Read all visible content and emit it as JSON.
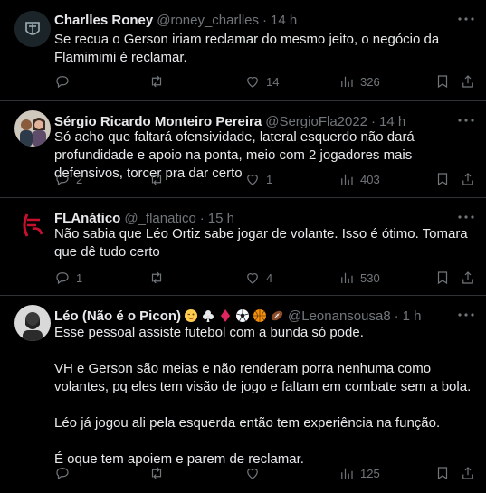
{
  "tweets": [
    {
      "name": "Charlles Roney",
      "handle": "@roney_charlles",
      "time": "14 h",
      "text": "Se recua o Gerson iriam reclamar do mesmo jeito, o negócio da Flamimimi é reclamar.",
      "replies": "",
      "retweets": "",
      "likes": "14",
      "views": "326"
    },
    {
      "name": "Sérgio Ricardo Monteiro Pereira",
      "handle": "@SergioFla2022",
      "time": "14 h",
      "text": "Só acho que faltará ofensividade, lateral esquerdo não dará profundidade e apoio na ponta, meio com 2 jogadores mais defensivos, torcer pra dar certo",
      "replies": "2",
      "retweets": "",
      "likes": "1",
      "views": "403"
    },
    {
      "name": "FLAnático",
      "handle": "@_flanatico",
      "time": "15 h",
      "text": "Não sabia que Léo Ortiz sabe jogar de volante. Isso é ótimo. Tomara que dê tudo certo",
      "replies": "1",
      "retweets": "",
      "likes": "4",
      "views": "530"
    },
    {
      "name": "Léo (Não é o Picon)",
      "handle": "@Leonansousa8",
      "time": "1 h",
      "text": "Esse pessoal assiste futebol com a bunda só pode.\n\nVH e Gerson são meias e não renderam porra nenhuma como volantes, pq eles tem visão de jogo e faltam em combate sem a bola.\n\nLéo já jogou ali pela esquerda então tem experiência na função.\n\nÉ oque tem apoiem e parem de reclamar.",
      "replies": "",
      "retweets": "",
      "likes": "",
      "views": "125",
      "emojis": [
        "wink-emoji",
        "club-suit-emoji",
        "diamond-suit-emoji",
        "soccer-ball-emoji",
        "basketball-emoji",
        "american-football-emoji"
      ]
    }
  ],
  "icons": {
    "reply": "reply-icon",
    "retweet": "retweet-icon",
    "like": "like-icon",
    "views": "views-icon",
    "bookmark": "bookmark-icon",
    "share": "share-icon",
    "more": "more-icon"
  },
  "colors": {
    "background": "#000000",
    "text": "#e7e9ea",
    "muted": "#71767b",
    "border": "#2f3336",
    "flamengo_red": "#c8102e"
  }
}
